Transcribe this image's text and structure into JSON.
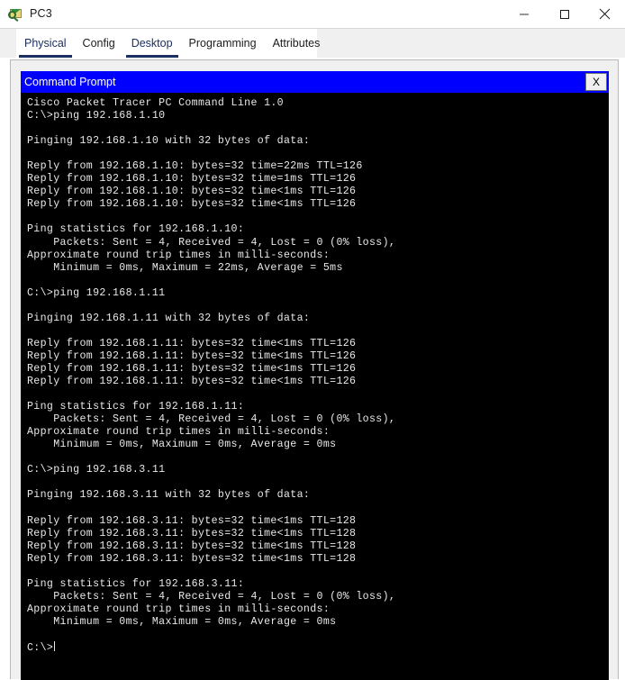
{
  "window": {
    "title": "PC3",
    "icon": "packet-tracer-icon",
    "controls": {
      "minimize": "minimize-icon",
      "maximize": "maximize-icon",
      "close": "close-icon"
    }
  },
  "tabs": [
    {
      "label": "Physical",
      "accent": true,
      "underline": true
    },
    {
      "label": "Config",
      "accent": false,
      "underline": false
    },
    {
      "label": "Desktop",
      "accent": true,
      "underline": true
    },
    {
      "label": "Programming",
      "accent": false,
      "underline": false
    },
    {
      "label": "Attributes",
      "accent": false,
      "underline": false
    }
  ],
  "command_prompt": {
    "title": "Command Prompt",
    "close_label": "X",
    "title_bar_color": "#0000ff",
    "background_color": "#000000",
    "text_color": "#e9e9e9",
    "prompt": "C:\\>",
    "lines": [
      "Cisco Packet Tracer PC Command Line 1.0",
      "C:\\>ping 192.168.1.10",
      "",
      "Pinging 192.168.1.10 with 32 bytes of data:",
      "",
      "Reply from 192.168.1.10: bytes=32 time=22ms TTL=126",
      "Reply from 192.168.1.10: bytes=32 time=1ms TTL=126",
      "Reply from 192.168.1.10: bytes=32 time<1ms TTL=126",
      "Reply from 192.168.1.10: bytes=32 time<1ms TTL=126",
      "",
      "Ping statistics for 192.168.1.10:",
      "    Packets: Sent = 4, Received = 4, Lost = 0 (0% loss),",
      "Approximate round trip times in milli-seconds:",
      "    Minimum = 0ms, Maximum = 22ms, Average = 5ms",
      "",
      "C:\\>ping 192.168.1.11",
      "",
      "Pinging 192.168.1.11 with 32 bytes of data:",
      "",
      "Reply from 192.168.1.11: bytes=32 time<1ms TTL=126",
      "Reply from 192.168.1.11: bytes=32 time<1ms TTL=126",
      "Reply from 192.168.1.11: bytes=32 time<1ms TTL=126",
      "Reply from 192.168.1.11: bytes=32 time<1ms TTL=126",
      "",
      "Ping statistics for 192.168.1.11:",
      "    Packets: Sent = 4, Received = 4, Lost = 0 (0% loss),",
      "Approximate round trip times in milli-seconds:",
      "    Minimum = 0ms, Maximum = 0ms, Average = 0ms",
      "",
      "C:\\>ping 192.168.3.11",
      "",
      "Pinging 192.168.3.11 with 32 bytes of data:",
      "",
      "Reply from 192.168.3.11: bytes=32 time<1ms TTL=128",
      "Reply from 192.168.3.11: bytes=32 time<1ms TTL=128",
      "Reply from 192.168.3.11: bytes=32 time<1ms TTL=128",
      "Reply from 192.168.3.11: bytes=32 time<1ms TTL=128",
      "",
      "Ping statistics for 192.168.3.11:",
      "    Packets: Sent = 4, Received = 4, Lost = 0 (0% loss),",
      "Approximate round trip times in milli-seconds:",
      "    Minimum = 0ms, Maximum = 0ms, Average = 0ms",
      ""
    ]
  }
}
